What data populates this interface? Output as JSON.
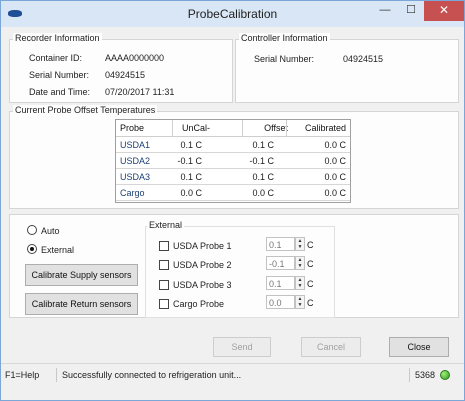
{
  "window": {
    "title": "ProbeCalibration",
    "minimize_glyph": "—",
    "maximize_glyph": "☐",
    "close_glyph": "✕"
  },
  "recorder": {
    "legend": "Recorder Information",
    "container_id_label": "Container ID:",
    "container_id_value": "AAAA0000000",
    "serial_label": "Serial Number:",
    "serial_value": "04924515",
    "datetime_label": "Date and Time:",
    "datetime_value": "07/20/2017 11:31"
  },
  "controller": {
    "legend": "Controller Information",
    "serial_label": "Serial Number:",
    "serial_value": "04924515"
  },
  "offsets": {
    "legend": "Current Probe Offset Temperatures",
    "columns": [
      "Probe",
      "UnCal-",
      "Offset",
      "Calibrated"
    ],
    "rows": [
      [
        "USDA1",
        "0.1 C",
        "0.1 C",
        "0.0 C"
      ],
      [
        "USDA2",
        "-0.1 C",
        "-0.1 C",
        "0.0 C"
      ],
      [
        "USDA3",
        "0.1 C",
        "0.1 C",
        "0.0 C"
      ],
      [
        "Cargo",
        "0.0 C",
        "0.0 C",
        "0.0 C"
      ]
    ]
  },
  "mode": {
    "auto_label": "Auto",
    "external_label": "External",
    "selected": "External",
    "calibrate_supply_label": "Calibrate Supply sensors",
    "calibrate_return_label": "Calibrate Return sensors"
  },
  "external": {
    "legend": "External",
    "probes": [
      {
        "label": "USDA Probe 1",
        "value": "0.1",
        "unit": "C"
      },
      {
        "label": "USDA Probe 2",
        "value": "-0.1",
        "unit": "C"
      },
      {
        "label": "USDA Probe 3",
        "value": "0.1",
        "unit": "C"
      },
      {
        "label": "Cargo Probe",
        "value": "0.0",
        "unit": "C"
      }
    ]
  },
  "buttons": {
    "send": "Send",
    "cancel": "Cancel",
    "close": "Close"
  },
  "status": {
    "help": "F1=Help",
    "message": "Successfully connected to refrigeration unit...",
    "code": "5368",
    "led_color": "#3cb521"
  }
}
